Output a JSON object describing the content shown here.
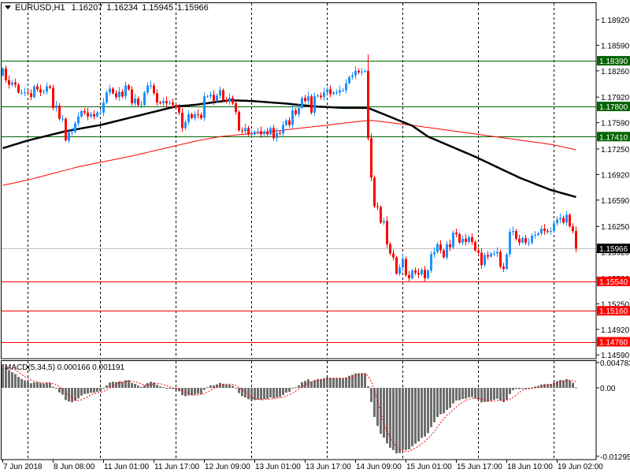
{
  "header": {
    "symbol_timeframe": "EURUSD,H1",
    "open": "1.16207",
    "high": "1.16234",
    "low": "1.15945",
    "close": "1.15966"
  },
  "macd_label": "MACD(5,34,5) 0.000166 0.001191",
  "chart_data": {
    "type": "candlestick",
    "symbol": "EURUSD",
    "timeframe": "H1",
    "ylim": [
      1.1459,
      1.1892
    ],
    "price_axis_labels": [
      "1.18920",
      "1.18590",
      "1.18260",
      "1.17920",
      "1.17590",
      "1.17250",
      "1.16920",
      "1.16590",
      "1.16250",
      "1.15920",
      "1.15580",
      "1.15250",
      "1.14920",
      "1.14590"
    ],
    "levels": [
      {
        "label": "1.18390",
        "price": 1.1839,
        "color": "#006400",
        "text_color": "#ffffff"
      },
      {
        "label": "1.17800",
        "price": 1.178,
        "color": "#006400",
        "text_color": "#ffffff"
      },
      {
        "label": "1.17410",
        "price": 1.1741,
        "color": "#006400",
        "text_color": "#ffffff"
      },
      {
        "label": "1.15966",
        "price": 1.15966,
        "color": "#c0c0c0",
        "tag_color": "#000000",
        "text_color": "#ffffff"
      },
      {
        "label": "1.15540",
        "price": 1.1554,
        "color": "#ff0000",
        "text_color": "#ffffff"
      },
      {
        "label": "1.15160",
        "price": 1.1516,
        "color": "#ff0000",
        "text_color": "#ffffff"
      },
      {
        "label": "1.14760",
        "price": 1.1476,
        "color": "#ff0000",
        "text_color": "#ffffff"
      }
    ],
    "first_open": 1.182,
    "closes": [
      1.1829,
      1.1814,
      1.1808,
      1.1811,
      1.1808,
      1.1798,
      1.1798,
      1.1798,
      1.1797,
      1.1792,
      1.1806,
      1.1802,
      1.1798,
      1.1799,
      1.1806,
      1.1804,
      1.1778,
      1.1781,
      1.1764,
      1.1764,
      1.1736,
      1.1747,
      1.1747,
      1.1758,
      1.1767,
      1.1774,
      1.1772,
      1.1767,
      1.177,
      1.1767,
      1.1772,
      1.1772,
      1.1785,
      1.1798,
      1.1803,
      1.1797,
      1.1792,
      1.1799,
      1.1793,
      1.1807,
      1.1802,
      1.1784,
      1.179,
      1.1782,
      1.1782,
      1.1798,
      1.1807,
      1.1807,
      1.1797,
      1.1785,
      1.1784,
      1.1787,
      1.1784,
      1.1785,
      1.1782,
      1.1779,
      1.1772,
      1.1752,
      1.176,
      1.177,
      1.1765,
      1.177,
      1.1769,
      1.1765,
      1.1793,
      1.1793,
      1.1795,
      1.1787,
      1.1794,
      1.1801,
      1.1788,
      1.1787,
      1.1791,
      1.1784,
      1.1773,
      1.1749,
      1.1748,
      1.1752,
      1.1744,
      1.1744,
      1.1747,
      1.1748,
      1.1744,
      1.1747,
      1.1744,
      1.1752,
      1.1739,
      1.1746,
      1.1745,
      1.1756,
      1.1762,
      1.1756,
      1.1775,
      1.177,
      1.1778,
      1.1791,
      1.1787,
      1.1793,
      1.1772,
      1.1793,
      1.1794,
      1.1792,
      1.1798,
      1.1802,
      1.1796,
      1.1798,
      1.1798,
      1.1801,
      1.1801,
      1.181,
      1.1818,
      1.182,
      1.1826,
      1.1824,
      1.1825,
      1.1826,
      1.1739,
      1.1688,
      1.1651,
      1.165,
      1.163,
      1.1632,
      1.1602,
      1.159,
      1.1585,
      1.1564,
      1.1572,
      1.1583,
      1.1562,
      1.1558,
      1.1568,
      1.1565,
      1.1563,
      1.1569,
      1.1558,
      1.1568,
      1.1589,
      1.1592,
      1.1602,
      1.1594,
      1.1585,
      1.1602,
      1.1598,
      1.1617,
      1.1615,
      1.1604,
      1.1609,
      1.1605,
      1.1611,
      1.1605,
      1.1594,
      1.1591,
      1.1575,
      1.1588,
      1.1586,
      1.159,
      1.159,
      1.1592,
      1.1573,
      1.157,
      1.1589,
      1.1618,
      1.1619,
      1.1609,
      1.1604,
      1.161,
      1.1604,
      1.1604,
      1.1613,
      1.1614,
      1.1616,
      1.1622,
      1.1619,
      1.1618,
      1.1619,
      1.1629,
      1.1634,
      1.1636,
      1.163,
      1.164,
      1.1625,
      1.1619,
      1.15966
    ],
    "spike_high": {
      "bar": 116,
      "price": 1.1847
    },
    "ma_black": [
      [
        0,
        1.1726
      ],
      [
        8,
        1.1736
      ],
      [
        20,
        1.1748
      ],
      [
        31,
        1.1756
      ],
      [
        41,
        1.1766
      ],
      [
        55,
        1.178
      ],
      [
        61,
        1.1782
      ],
      [
        72,
        1.1788
      ],
      [
        79,
        1.1787
      ],
      [
        89,
        1.1784
      ],
      [
        99,
        1.178
      ],
      [
        109,
        1.1778
      ],
      [
        116,
        1.1778
      ],
      [
        130,
        1.1755
      ],
      [
        135,
        1.1741
      ],
      [
        150,
        1.1715
      ],
      [
        164,
        1.1688
      ],
      [
        174,
        1.1672
      ],
      [
        182,
        1.1663
      ]
    ],
    "ma_red": [
      [
        0,
        1.1678
      ],
      [
        8,
        1.1685
      ],
      [
        24,
        1.1702
      ],
      [
        41,
        1.1716
      ],
      [
        61,
        1.1735
      ],
      [
        69,
        1.1741
      ],
      [
        84,
        1.1747
      ],
      [
        99,
        1.1754
      ],
      [
        114,
        1.1761
      ],
      [
        117,
        1.1762
      ],
      [
        131,
        1.1755
      ],
      [
        149,
        1.1745
      ],
      [
        174,
        1.1731
      ],
      [
        182,
        1.1724
      ]
    ],
    "macd": {
      "fast": 5,
      "slow": 34,
      "signal": 5,
      "seed_fast_ema": 1.1822,
      "seed_slow_ema": 1.1777,
      "axis_labels": [
        {
          "label": "0.004783",
          "value": 0.004783
        },
        {
          "label": "0.00",
          "value": 0
        },
        {
          "label": "-0.01295",
          "value": -0.01295
        }
      ]
    },
    "grid_bars": [
      8,
      31,
      55,
      79,
      103,
      127,
      151,
      175
    ],
    "time_labels": [
      {
        "bar": 0,
        "label": "7 Jun 2018"
      },
      {
        "bar": 16,
        "label": "8 Jun 08:00"
      },
      {
        "bar": 32,
        "label": "11 Jun 01:00"
      },
      {
        "bar": 48,
        "label": "11 Jun 17:00"
      },
      {
        "bar": 64,
        "label": "12 Jun 09:00"
      },
      {
        "bar": 80,
        "label": "13 Jun 01:00"
      },
      {
        "bar": 96,
        "label": "13 Jun 17:00"
      },
      {
        "bar": 112,
        "label": "14 Jun 09:00"
      },
      {
        "bar": 128,
        "label": "15 Jun 01:00"
      },
      {
        "bar": 144,
        "label": "15 Jun 17:00"
      },
      {
        "bar": 160,
        "label": "18 Jun 10:00"
      },
      {
        "bar": 176,
        "label": "19 Jun 02:00"
      }
    ],
    "colors": {
      "bull": "#1e90ff",
      "bear": "#ff0000",
      "macd_hist": "#6e6e6e",
      "macd_signal": "#ff0000",
      "ma_black": "#000000",
      "ma_red": "#ff0000"
    }
  }
}
